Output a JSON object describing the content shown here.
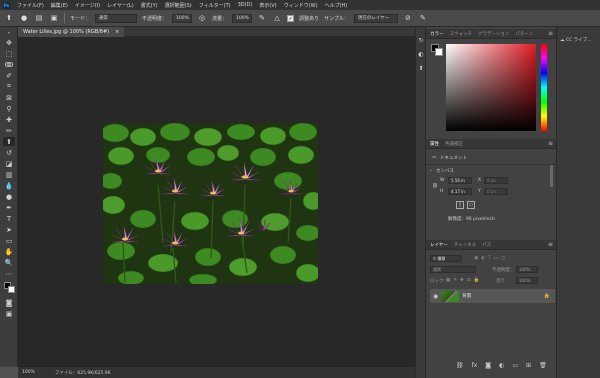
{
  "app": {
    "logo": "Ps"
  },
  "menu": [
    "ファイル(F)",
    "編集(E)",
    "イメージ(I)",
    "レイヤー(L)",
    "書式(Y)",
    "選択範囲(S)",
    "フィルター(T)",
    "3D(D)",
    "表示(V)",
    "ウィンドウ(W)",
    "ヘルプ(H)"
  ],
  "options": {
    "brush_size": "",
    "mode_label": "モード：",
    "mode_value": "通常",
    "opacity_label": "不透明度：",
    "opacity_value": "100%",
    "flow_label": "流量：",
    "flow_value": "100%",
    "aligned_label": "調整あり",
    "sample_label": "サンプル：",
    "sample_value": "現在のレイヤー"
  },
  "document_tab": {
    "title": "Water Lilies.jpg @ 100% (RGB/8#)",
    "close": "×"
  },
  "status": {
    "zoom": "100%",
    "file_info": "ファイル：625.9K/625.9K"
  },
  "color_panel": {
    "tabs": [
      "カラー",
      "スウォッチ",
      "グラデーション",
      "パターン"
    ],
    "active": 0
  },
  "properties_panel": {
    "tabs": [
      "属性",
      "色調補正"
    ],
    "doc_label": "ドキュメント",
    "section": "カンバス",
    "w_label": "W",
    "w_value": "5.56 in",
    "x_label": "X",
    "x_value": "0 px",
    "h_label": "H",
    "h_value": "4.17 in",
    "y_label": "Y",
    "y_value": "0 px",
    "resolution": "解像度：96 pixel/inch"
  },
  "layers_panel": {
    "tabs": [
      "レイヤー",
      "チャンネル",
      "パス"
    ],
    "search_placeholder": "種類",
    "blend": "通常",
    "opacity_label": "不透明度：",
    "opacity_value": "100%",
    "lock_label": "ロック：",
    "fill_label": "塗り：",
    "fill_value": "100%",
    "layer_name": "背景"
  },
  "cc_panel": {
    "label": "CC ライブ..."
  },
  "colors": {
    "accent": "#31a8ff",
    "app_bg": "#535353",
    "canvas_bg": "#282828",
    "foreground": "#000000",
    "background": "#ffffff"
  }
}
